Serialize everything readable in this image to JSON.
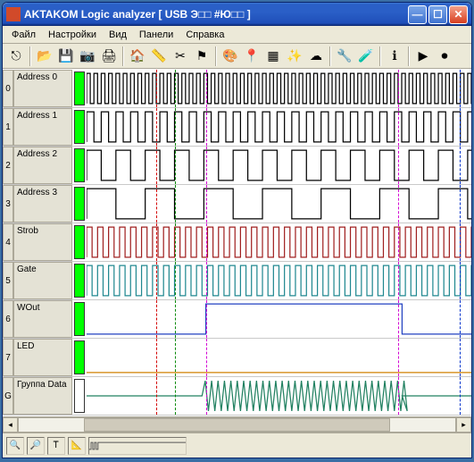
{
  "title": "AKTAKOM Logic analyzer [ USB Э□□ #Ю□□ ]",
  "menu": {
    "file": "Файл",
    "settings": "Настройки",
    "view": "Вид",
    "panels": "Панели",
    "help": "Справка"
  },
  "toolbar_icons": [
    "exit-icon",
    "sep",
    "open-icon",
    "save-icon",
    "photo-icon",
    "print-icon",
    "sep",
    "home-icon",
    "ruler-icon",
    "cut-icon",
    "flag-icon",
    "sep",
    "palette-icon",
    "marker-icon",
    "tables-icon",
    "wand-icon",
    "cloud-icon",
    "sep",
    "tool1-icon",
    "tool2-icon",
    "sep",
    "info-icon",
    "sep",
    "play-icon",
    "record-icon"
  ],
  "channels": [
    {
      "num": "0",
      "label": "Address 0",
      "color": "#00ff00",
      "wave_color": "#000000",
      "period": 8
    },
    {
      "num": "1",
      "label": "Address 1",
      "color": "#00ff00",
      "wave_color": "#000000",
      "period": 16
    },
    {
      "num": "2",
      "label": "Address 2",
      "color": "#00ff00",
      "wave_color": "#000000",
      "period": 32
    },
    {
      "num": "3",
      "label": "Address 3",
      "color": "#00ff00",
      "wave_color": "#000000",
      "period": 64
    },
    {
      "num": "4",
      "label": "Strob",
      "color": "#00ff00",
      "wave_color": "#a02020",
      "period": 12
    },
    {
      "num": "5",
      "label": "Gate",
      "color": "#00ff00",
      "wave_color": "#208890",
      "period": 12
    },
    {
      "num": "6",
      "label": "WOut",
      "color": "#00ff00",
      "wave_color": "#2040c0",
      "type": "step"
    },
    {
      "num": "7",
      "label": "LED",
      "color": "#00ff00",
      "wave_color": "#d08000",
      "type": "flat"
    },
    {
      "num": "G",
      "label": "Группа Data",
      "color": "#ffffff",
      "wave_color": "#208060",
      "type": "burst"
    }
  ],
  "cursors": [
    {
      "id": "A",
      "pos": 0.18,
      "color": "red"
    },
    {
      "id": "1",
      "pos": 0.23,
      "color": "green"
    },
    {
      "id": "2",
      "pos": 0.31,
      "color": "mag"
    },
    {
      "id": "3",
      "pos": 0.81,
      "color": "mag"
    },
    {
      "id": "B",
      "pos": 0.97,
      "color": "blue"
    }
  ],
  "status_tools": [
    "zoom-in-icon",
    "zoom-out-icon",
    "text-cursor-icon",
    "ruler-vert-icon"
  ]
}
